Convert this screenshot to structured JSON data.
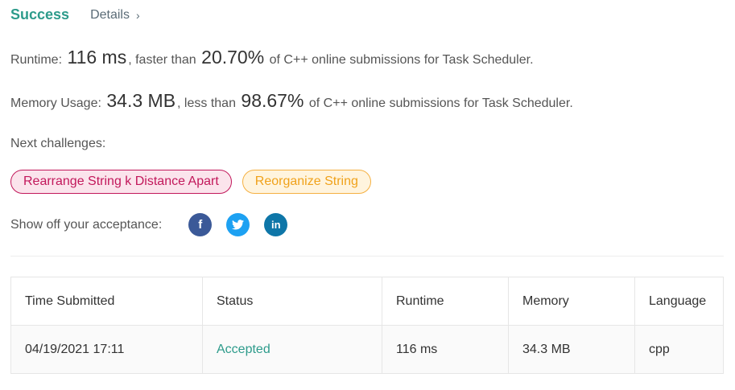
{
  "header": {
    "status": "Success",
    "details_label": "Details",
    "details_chevron": "›"
  },
  "runtime": {
    "label": "Runtime:",
    "value": "116 ms",
    "mid": ", faster than",
    "percent": "20.70%",
    "tail": "of C++ online submissions for Task Scheduler."
  },
  "memory": {
    "label": "Memory Usage:",
    "value": "34.3 MB",
    "mid": ", less than",
    "percent": "98.67%",
    "tail": "of C++ online submissions for Task Scheduler."
  },
  "next_challenges": {
    "label": "Next challenges:",
    "items": [
      {
        "title": "Rearrange String k Distance Apart",
        "difficulty_color": "#c2185b"
      },
      {
        "title": "Reorganize String",
        "difficulty_color": "#f0a21b"
      }
    ]
  },
  "share": {
    "label": "Show off your acceptance:",
    "icons": [
      {
        "name": "facebook-icon",
        "glyph": "f"
      },
      {
        "name": "twitter-icon",
        "glyph": "t"
      },
      {
        "name": "linkedin-icon",
        "glyph": "in"
      }
    ]
  },
  "table": {
    "headers": [
      "Time Submitted",
      "Status",
      "Runtime",
      "Memory",
      "Language"
    ],
    "rows": [
      [
        "04/19/2021 17:11",
        "Accepted",
        "116 ms",
        "34.3 MB",
        "cpp"
      ]
    ]
  },
  "colors": {
    "accent": "#2d9b8b",
    "hard": "#c2185b",
    "medium": "#f0a21b"
  }
}
